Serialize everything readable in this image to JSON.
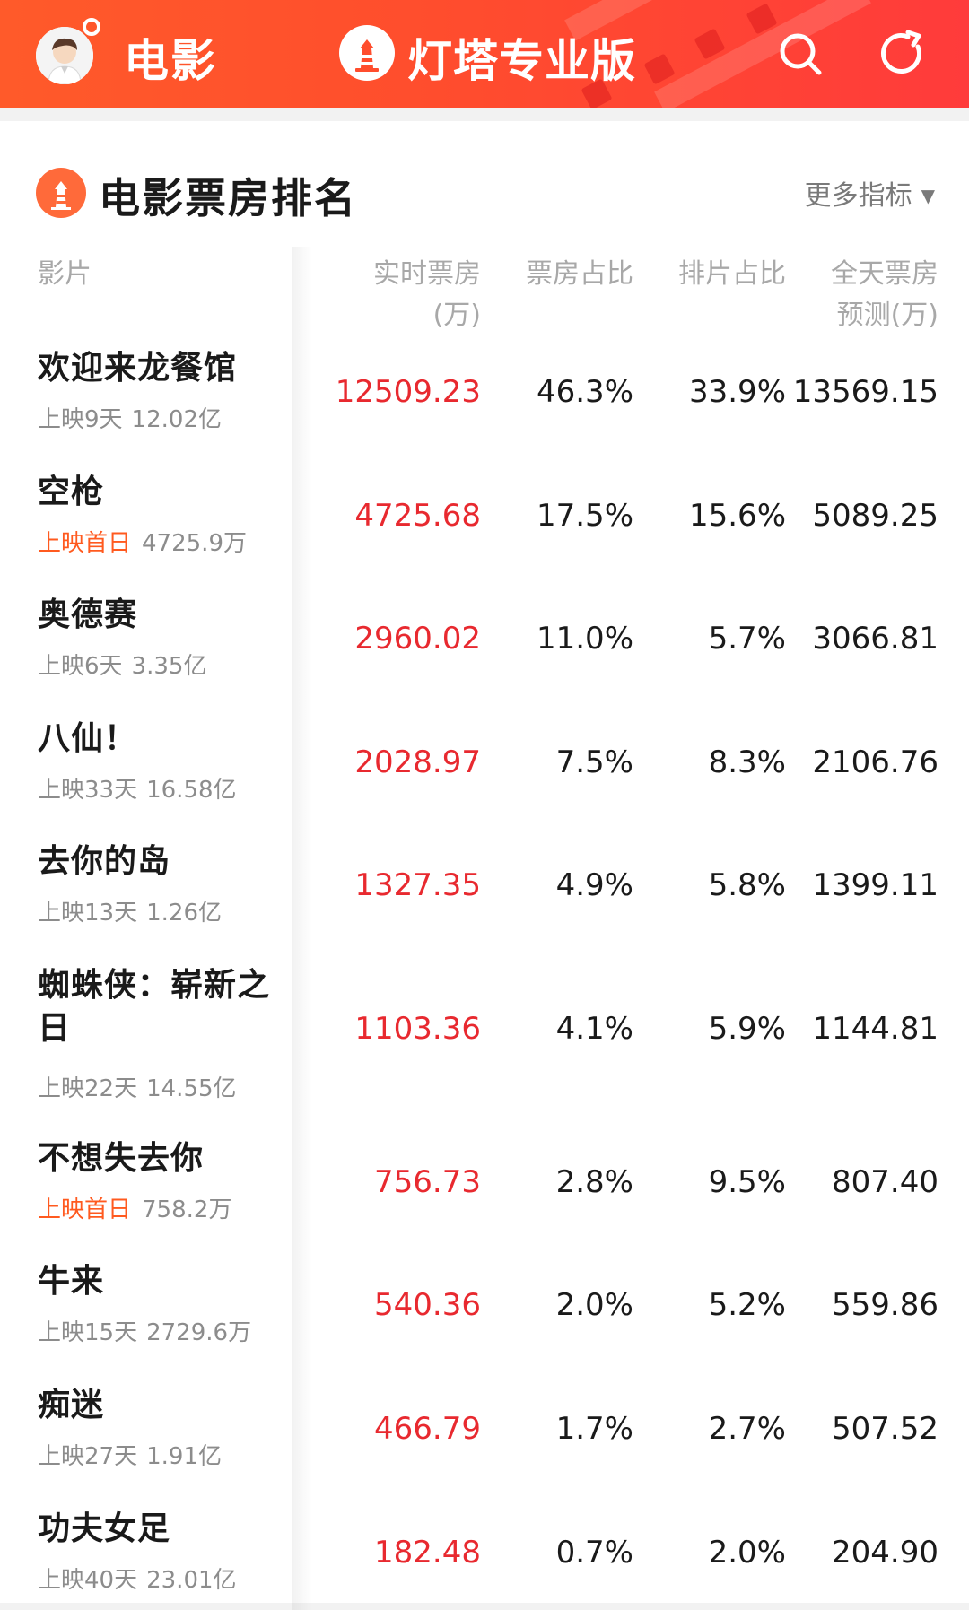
{
  "header": {
    "title": "电影",
    "brand": "灯塔专业版"
  },
  "card": {
    "title": "电影票房排名",
    "more_label": "更多指标",
    "columns": {
      "film": "影片",
      "live_line1": "实时票房",
      "live_line2": "(万)",
      "box_share": "票房占比",
      "sched_share": "排片占比",
      "forecast_line1": "全天票房",
      "forecast_line2": "预测(万)"
    }
  },
  "colors": {
    "accent": "#ff4d2d",
    "live_value": "#e8292f",
    "first_day_tag": "#ff5a1f"
  },
  "movies": [
    {
      "name": "欢迎来龙餐馆",
      "days": "上映9天",
      "total": "12.02亿",
      "first_day": false,
      "live": "12509.23",
      "box_share": "46.3%",
      "sched_share": "33.9%",
      "forecast": "13569.15"
    },
    {
      "name": "空枪",
      "days": "上映首日",
      "total": "4725.9万",
      "first_day": true,
      "live": "4725.68",
      "box_share": "17.5%",
      "sched_share": "15.6%",
      "forecast": "5089.25"
    },
    {
      "name": "奥德赛",
      "days": "上映6天",
      "total": "3.35亿",
      "first_day": false,
      "live": "2960.02",
      "box_share": "11.0%",
      "sched_share": "5.7%",
      "forecast": "3066.81"
    },
    {
      "name": "八仙！",
      "days": "上映33天",
      "total": "16.58亿",
      "first_day": false,
      "live": "2028.97",
      "box_share": "7.5%",
      "sched_share": "8.3%",
      "forecast": "2106.76"
    },
    {
      "name": "去你的岛",
      "days": "上映13天",
      "total": "1.26亿",
      "first_day": false,
      "live": "1327.35",
      "box_share": "4.9%",
      "sched_share": "5.8%",
      "forecast": "1399.11"
    },
    {
      "name": "蜘蛛侠：崭新之日",
      "days": "上映22天",
      "total": "14.55亿",
      "first_day": false,
      "live": "1103.36",
      "box_share": "4.1%",
      "sched_share": "5.9%",
      "forecast": "1144.81"
    },
    {
      "name": "不想失去你",
      "days": "上映首日",
      "total": "758.2万",
      "first_day": true,
      "live": "756.73",
      "box_share": "2.8%",
      "sched_share": "9.5%",
      "forecast": "807.40"
    },
    {
      "name": "牛来",
      "days": "上映15天",
      "total": "2729.6万",
      "first_day": false,
      "live": "540.36",
      "box_share": "2.0%",
      "sched_share": "5.2%",
      "forecast": "559.86"
    },
    {
      "name": "痴迷",
      "days": "上映27天",
      "total": "1.91亿",
      "first_day": false,
      "live": "466.79",
      "box_share": "1.7%",
      "sched_share": "2.7%",
      "forecast": "507.52"
    },
    {
      "name": "功夫女足",
      "days": "上映40天",
      "total": "23.01亿",
      "first_day": false,
      "live": "182.48",
      "box_share": "0.7%",
      "sched_share": "2.0%",
      "forecast": "204.90"
    }
  ]
}
